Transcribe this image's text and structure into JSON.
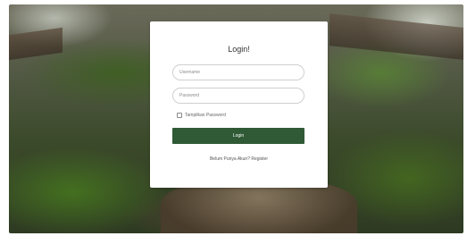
{
  "login": {
    "title": "Login!",
    "username_placeholder": "Username",
    "password_placeholder": "Password",
    "show_password_label": "Tampilkan Password",
    "login_button": "Login",
    "register_text": "Belum Punya Akun? Register"
  },
  "colors": {
    "button": "#2f5a35",
    "card": "#ffffff"
  }
}
